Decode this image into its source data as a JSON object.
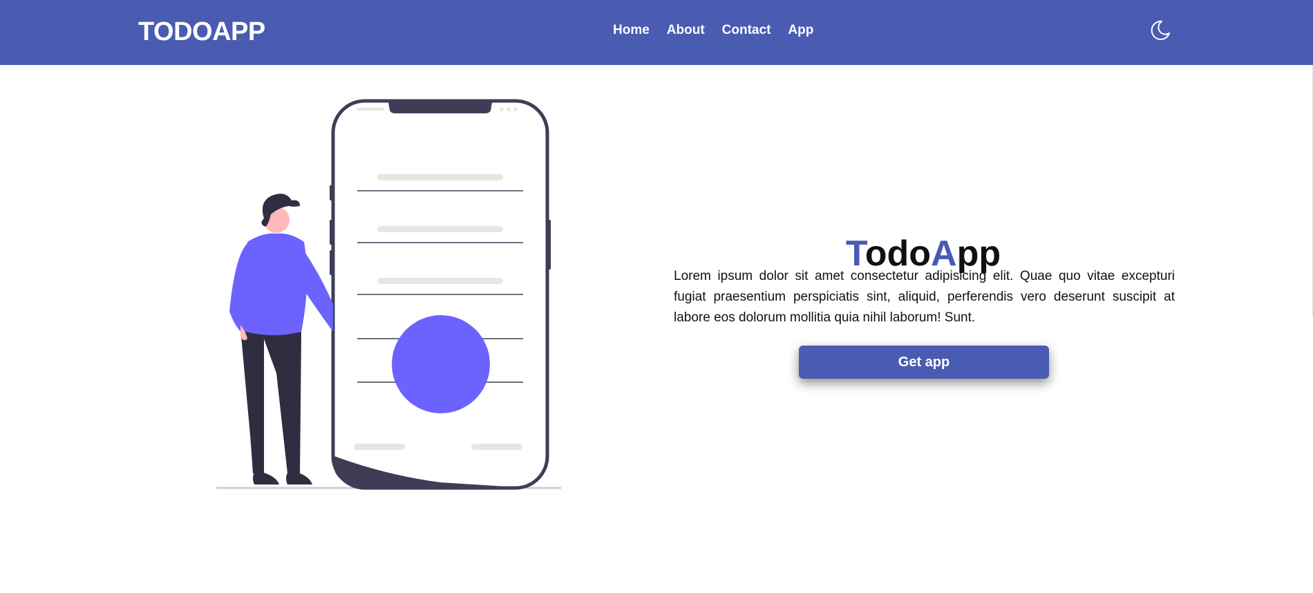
{
  "navbar": {
    "brand": "TODOAPP",
    "links": [
      "Home",
      "About",
      "Contact",
      "App"
    ],
    "theme_toggle_icon": "moon-icon"
  },
  "hero": {
    "title_parts": [
      "T",
      "odo",
      "A",
      "pp"
    ],
    "description": "Lorem ipsum dolor sit amet consectetur adipisicing elit. Quae quo vitae excepturi fugiat praesentium perspiciatis sint, aliquid, perferendis vero deserunt suscipit at labore eos dolorum mollitia quia nihil laborum! Sunt.",
    "button_label": "Get app",
    "illustration": "person-with-phone-illustration"
  },
  "colors": {
    "brand": "#4a5bb2",
    "illustration_accent": "#6c63ff",
    "dark": "#3f3d56",
    "text": "#111111"
  }
}
